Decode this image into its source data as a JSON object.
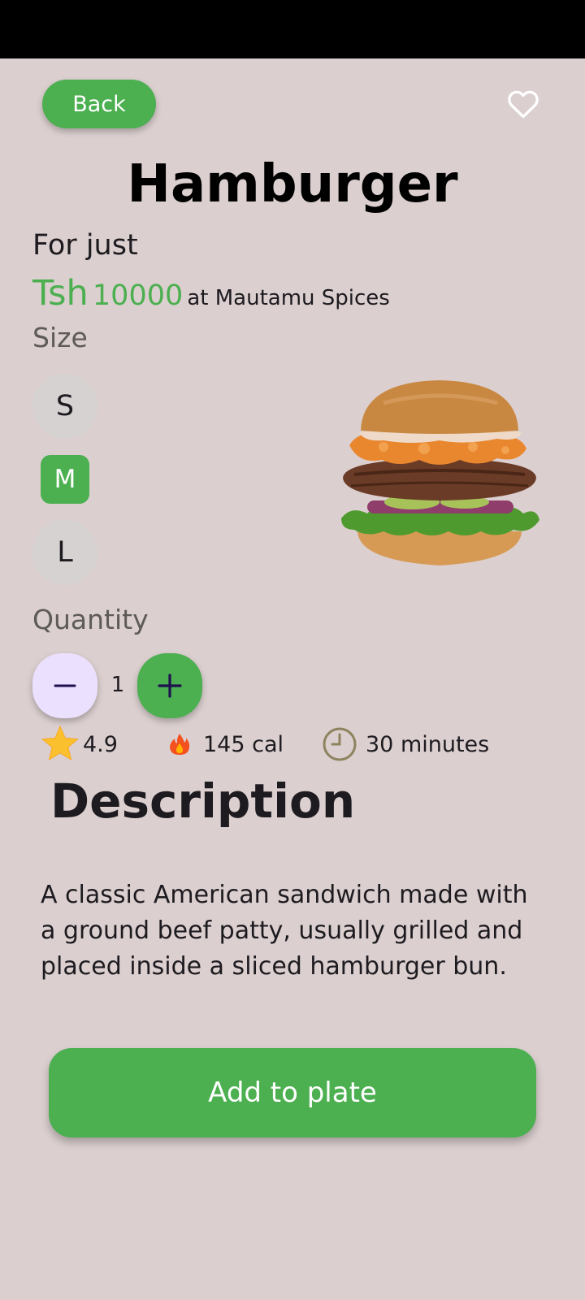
{
  "header": {
    "back_label": "Back",
    "favorite_icon": "heart-outline-icon"
  },
  "product": {
    "name": "Hamburger",
    "price_prefix": "For just",
    "currency": "Tsh",
    "price": "10000",
    "vendor_text": "at Mautamu Spices",
    "image_icon": "hamburger-image"
  },
  "size": {
    "label": "Size",
    "options": [
      "S",
      "M",
      "L"
    ],
    "selected": "M"
  },
  "quantity": {
    "label": "Quantity",
    "value": "1",
    "decrement_icon": "minus-icon",
    "increment_icon": "plus-icon"
  },
  "stats": {
    "rating": "4.9",
    "calories": "145 cal",
    "time": "30 minutes"
  },
  "description": {
    "title": "Description",
    "text": "A classic American sandwich made with a ground beef patty, usually grilled and placed inside a sliced hamburger bun."
  },
  "actions": {
    "add_label": "Add to plate"
  },
  "colors": {
    "accent": "#4caf50",
    "background": "#dbcfcf",
    "minus_button": "#ebe0fd",
    "size_chip": "#d6d2d2"
  }
}
